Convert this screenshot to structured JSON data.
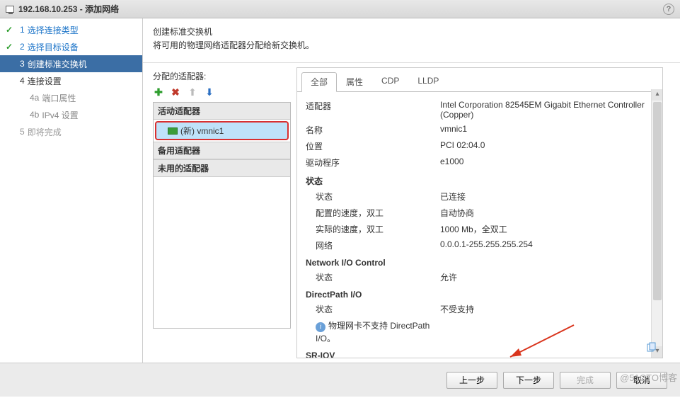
{
  "window": {
    "title": "192.168.10.253 - 添加网络",
    "help_glyph": "?"
  },
  "steps": {
    "s1": {
      "num": "1",
      "label": "选择连接类型"
    },
    "s2": {
      "num": "2",
      "label": "选择目标设备"
    },
    "s3": {
      "num": "3",
      "label": "创建标准交换机"
    },
    "s4": {
      "num": "4",
      "label": "连接设置"
    },
    "s4a": {
      "num": "4a",
      "label": "端口属性"
    },
    "s4b": {
      "num": "4b",
      "label": "IPv4 设置"
    },
    "s5": {
      "num": "5",
      "label": "即将完成"
    }
  },
  "instruct": {
    "title": "创建标准交换机",
    "desc": "将可用的物理网络适配器分配给新交换机。"
  },
  "leftpane": {
    "section_title": "分配的适配器:",
    "groups": {
      "active": "活动适配器",
      "standby": "备用适配器",
      "unused": "未用的适配器"
    },
    "item": "(新) vmnic1"
  },
  "tabs": {
    "all": "全部",
    "props": "属性",
    "cdp": "CDP",
    "lldp": "LLDP"
  },
  "props": {
    "adapter_l": "适配器",
    "adapter_v": "Intel Corporation 82545EM Gigabit Ethernet Controller (Copper)",
    "name_l": "名称",
    "name_v": "vmnic1",
    "loc_l": "位置",
    "loc_v": "PCI 02:04.0",
    "drv_l": "驱动程序",
    "drv_v": "e1000",
    "state_h": "状态",
    "state_l": "状态",
    "state_v": "已连接",
    "cfg_l": "配置的速度，双工",
    "cfg_v": "自动协商",
    "act_l": "实际的速度，双工",
    "act_v": "1000 Mb，全双工",
    "net_l": "网络",
    "net_v": "0.0.0.1-255.255.255.254",
    "nio_h": "Network I/O Control",
    "nio_l": "状态",
    "nio_v": "允许",
    "dp_h": "DirectPath I/O",
    "dp_l": "状态",
    "dp_v": "不受支持",
    "dp_msg": "物理网卡不支持 DirectPath I/O。",
    "sriov_h": "SR-IOV"
  },
  "footer": {
    "back": "上一步",
    "next": "下一步",
    "finish": "完成",
    "cancel": "取消"
  },
  "watermark": "@51CTO博客"
}
